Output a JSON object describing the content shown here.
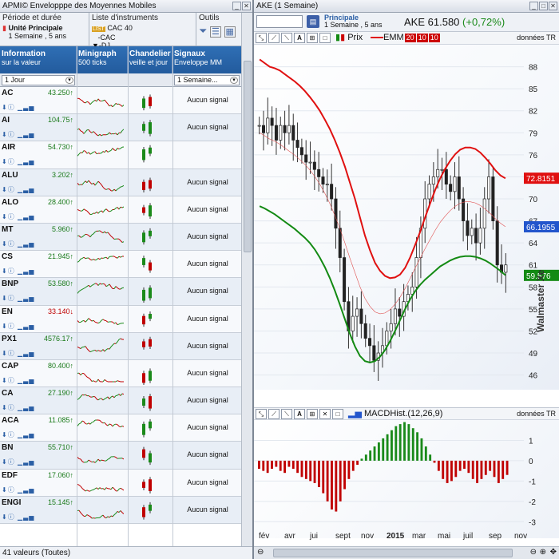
{
  "left_window": {
    "title": "APMI© Envelopppe des Moyennes Mobiles"
  },
  "right_window": {
    "title": "AKE (1 Semaine)"
  },
  "left_header": {
    "period_label": "Période et durée",
    "period_unit": "Unité Principale",
    "period_value": "1 Semaine , 5 ans",
    "instruments_label": "Liste d'instruments",
    "instruments_list": [
      "CAC 40",
      "-CAC",
      "-DJ"
    ],
    "tools_label": "Outils"
  },
  "columns": [
    {
      "title": "Information",
      "sub": "sur la valeur"
    },
    {
      "title": "Minigraph",
      "sub": "500 ticks"
    },
    {
      "title": "Chandelier",
      "sub": "veille et jour"
    },
    {
      "title": "Signaux",
      "sub": "Enveloppe MM"
    }
  ],
  "filters": {
    "period": "1 Jour",
    "signal_period": "1 Semaine..."
  },
  "rows": [
    {
      "name": "AC",
      "price": "43.250↑",
      "dir": "up",
      "signal": "Aucun signal"
    },
    {
      "name": "AI",
      "price": "104.75↑",
      "dir": "up",
      "signal": "Aucun signal"
    },
    {
      "name": "AIR",
      "price": "54.730↑",
      "dir": "up",
      "signal": ""
    },
    {
      "name": "ALU",
      "price": "3.202↑",
      "dir": "up",
      "signal": "Aucun signal"
    },
    {
      "name": "ALO",
      "price": "28.400↑",
      "dir": "up",
      "signal": "Aucun signal"
    },
    {
      "name": "MT",
      "price": "5.960↑",
      "dir": "up",
      "signal": "Aucun signal"
    },
    {
      "name": "CS",
      "price": "21.945↑",
      "dir": "up",
      "signal": "Aucun signal"
    },
    {
      "name": "BNP",
      "price": "53.580↑",
      "dir": "up",
      "signal": "Aucun signal"
    },
    {
      "name": "EN",
      "price": "33.140↓",
      "dir": "down",
      "signal": "Aucun signal"
    },
    {
      "name": "PX1",
      "price": "4576.17↑",
      "dir": "up",
      "signal": "Aucun signal"
    },
    {
      "name": "CAP",
      "price": "80.400↑",
      "dir": "up",
      "signal": "Aucun signal"
    },
    {
      "name": "CA",
      "price": "27.190↑",
      "dir": "up",
      "signal": "Aucun signal"
    },
    {
      "name": "ACA",
      "price": "11.085↑",
      "dir": "up",
      "signal": "Aucun signal"
    },
    {
      "name": "BN",
      "price": "55.710↑",
      "dir": "up",
      "signal": "Aucun signal"
    },
    {
      "name": "EDF",
      "price": "17.060↑",
      "dir": "up",
      "signal": "Aucun signal"
    },
    {
      "name": "ENGI",
      "price": "15.145↑",
      "dir": "up",
      "signal": "Aucun signal"
    }
  ],
  "status": {
    "count": "41 valeurs (Toutes)"
  },
  "chart_header": {
    "unit_label": "Principale",
    "unit_value": "1 Semaine , 5 ans",
    "symbol": "AKE",
    "price": "61.580",
    "change": "(+0,72%)",
    "series_price": "Prix",
    "series_emm": "EMM",
    "emm_params": [
      "20",
      "10",
      "10"
    ],
    "donnees": "données TR"
  },
  "macd_header": {
    "label": "MACDHist.(12,26,9)",
    "donnees": "données TR"
  },
  "watermark": "Walmaster Xe",
  "colors": {
    "up": "#1a8a1a",
    "down": "#c00000",
    "upper": "#e01010",
    "lower": "#138a13",
    "header": "#1f5596"
  },
  "chart_data": [
    {
      "type": "candlestick",
      "title": "AKE (1 Semaine)",
      "y_ticks": [
        46,
        49,
        52,
        55,
        58,
        61,
        64,
        67,
        70,
        73,
        76,
        79,
        82,
        85,
        88
      ],
      "ylim": [
        44,
        91
      ],
      "x_ticks": [
        "fév",
        "avr",
        "jui",
        "sept",
        "nov",
        "2015",
        "mar",
        "mai",
        "juil",
        "sep",
        "nov"
      ],
      "price_tags": [
        {
          "value": "72.8151",
          "color": "#e01010"
        },
        {
          "value": "66.1955",
          "color": "#2255cc"
        },
        {
          "value": "59.576",
          "color": "#138a13"
        }
      ],
      "close": [
        80,
        79,
        81,
        80,
        78,
        80,
        79,
        80,
        78,
        77,
        76,
        75,
        75,
        74,
        73,
        72,
        72,
        70,
        66,
        62,
        56,
        52,
        54,
        55,
        53,
        51,
        50,
        48,
        49,
        50,
        52,
        53,
        55,
        54,
        56,
        57,
        58,
        62,
        66,
        70,
        72,
        73,
        74,
        74,
        72,
        71,
        73,
        70,
        67,
        65,
        66,
        64,
        66,
        70,
        73,
        67,
        61,
        60,
        61
      ],
      "upper": [
        89,
        88.5,
        88,
        87.8,
        87.5,
        87,
        86.5,
        86,
        85.4,
        84.7,
        83.9,
        83,
        82,
        80.8,
        79.5,
        78,
        76.3,
        74.4,
        72.2,
        70,
        67.5,
        65,
        63,
        61.3,
        60.2,
        59.5,
        59.2,
        59.3,
        59.7,
        60.6,
        62,
        63.7,
        65.5,
        67.5,
        69.4,
        71.2,
        72.8,
        74.1,
        75.2,
        76.1,
        76.7,
        77,
        77,
        76.8,
        76.3,
        75.6,
        74.8,
        73.9,
        73.2,
        72.8
      ],
      "lower": [
        69,
        68.7,
        68.3,
        67.9,
        67.4,
        66.9,
        66.4,
        65.9,
        65.3,
        64.7,
        64,
        63.1,
        62,
        60.7,
        59.2,
        57.5,
        55.6,
        53.6,
        51.6,
        49.9,
        48.6,
        47.9,
        47.7,
        47.9,
        48.5,
        49.4,
        50.6,
        52,
        53.5,
        55,
        56.3,
        57.4,
        58.3,
        59,
        59.6,
        60.2,
        60.8,
        61.2,
        61.6,
        61.9,
        62.1,
        62.2,
        62.2,
        62.1,
        61.9,
        61.6,
        61.2,
        60.7,
        60.2,
        59.6
      ]
    },
    {
      "type": "bar",
      "title": "MACDHist.(12,26,9)",
      "y_ticks": [
        1,
        0,
        -1,
        -2,
        -3
      ],
      "ylim": [
        -3.5,
        2
      ],
      "values": [
        -0.4,
        -0.5,
        -0.6,
        -0.4,
        -0.3,
        -0.5,
        -0.6,
        -0.3,
        -0.4,
        -0.6,
        -0.8,
        -0.9,
        -1,
        -1.1,
        -1.3,
        -1.6,
        -2,
        -2.4,
        -2.5,
        -2,
        -1.4,
        -0.9,
        -0.5,
        -0.2,
        0.1,
        0.3,
        0.5,
        0.7,
        0.9,
        1.1,
        1.3,
        1.5,
        1.7,
        1.8,
        1.9,
        1.8,
        1.6,
        1.4,
        1.1,
        0.7,
        0.3,
        -0.1,
        -0.5,
        -0.9,
        -1.1,
        -1,
        -0.8,
        -0.5,
        -0.4,
        -0.6,
        -0.9,
        -1.1,
        -0.9,
        -0.7,
        -0.5,
        -0.8,
        -1.1,
        -0.9,
        -0.7
      ]
    }
  ]
}
